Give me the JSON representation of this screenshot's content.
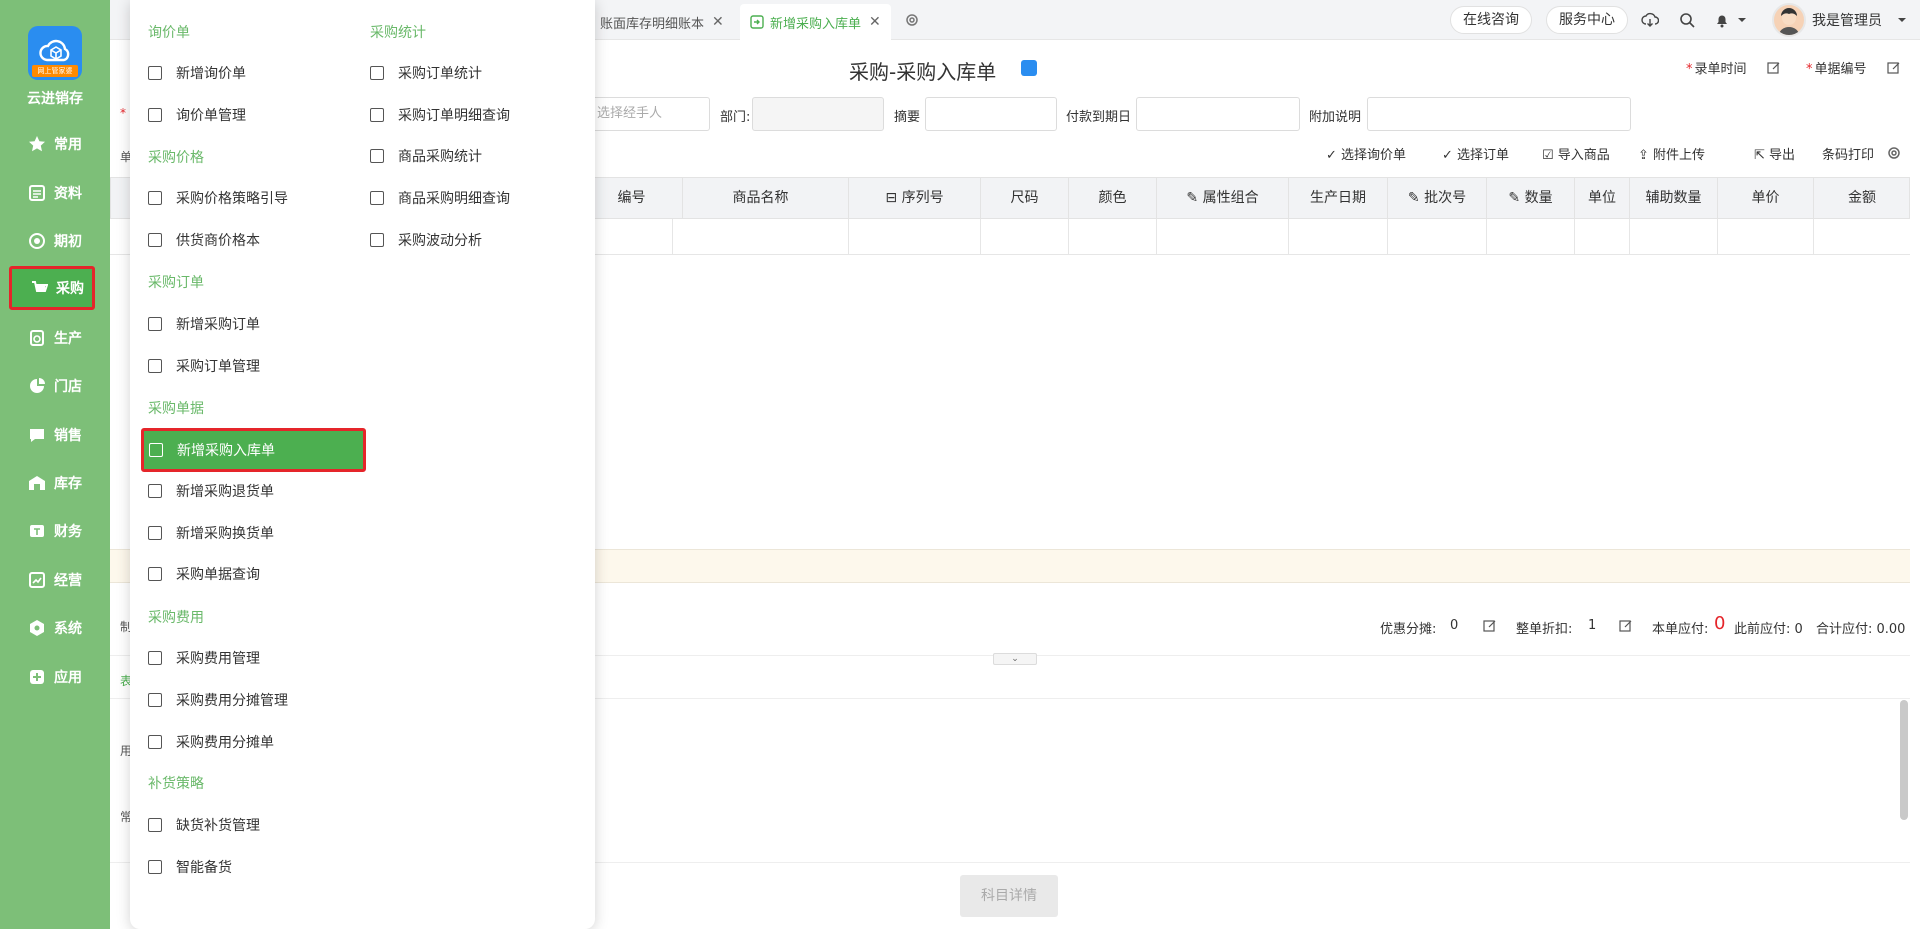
{
  "sidebar": {
    "brand": "云进销存",
    "logo_badge": "网上管家婆",
    "items": [
      {
        "label": "常用",
        "icon": "star-icon"
      },
      {
        "label": "资料",
        "icon": "document-icon"
      },
      {
        "label": "期初",
        "icon": "target-icon"
      },
      {
        "label": "采购",
        "icon": "cart-icon",
        "active": true
      },
      {
        "label": "生产",
        "icon": "gear-doc-icon"
      },
      {
        "label": "门店",
        "icon": "pie-icon"
      },
      {
        "label": "销售",
        "icon": "chat-icon"
      },
      {
        "label": "库存",
        "icon": "warehouse-icon"
      },
      {
        "label": "财务",
        "icon": "finance-icon"
      },
      {
        "label": "经营",
        "icon": "trend-icon"
      },
      {
        "label": "系统",
        "icon": "hexagon-icon"
      },
      {
        "label": "应用",
        "icon": "plus-square-icon"
      }
    ]
  },
  "tabs": [
    {
      "label": "账面库存明细账本",
      "active": false
    },
    {
      "label": "新增采购入库单",
      "active": true
    }
  ],
  "topbar": {
    "online_consult": "在线咨询",
    "service_center": "服务中心",
    "username": "我是管理员"
  },
  "form": {
    "title": "采购-采购入库单",
    "record_time_label": "录单时间",
    "doc_number_label": "单据编号",
    "handler_placeholder": "选择经手人",
    "dept_label": "部门:",
    "summary_label": "摘要",
    "due_date_label": "付款到期日",
    "extra_label": "附加说明",
    "leading_req": "*",
    "leading_frag": "单"
  },
  "toolbar": {
    "select_inquiry": "选择询价单",
    "select_order": "选择订单",
    "import_goods": "导入商品",
    "upload_attachment": "附件上传",
    "export": "导出",
    "barcode_print": "条码打印"
  },
  "table": {
    "columns": [
      "编号",
      "商品名称",
      "序列号",
      "尺码",
      "颜色",
      "属性组合",
      "生产日期",
      "批次号",
      "数量",
      "单位",
      "辅助数量",
      "单价",
      "金额"
    ]
  },
  "footer": {
    "discount_share_label": "优惠分摊:",
    "discount_share_value": "0",
    "whole_discount_label": "整单折扣:",
    "whole_discount_value": "1",
    "current_payable_label": "本单应付:",
    "current_payable_value": "0",
    "previous_payable_label": "此前应付: 0",
    "total_payable_label": "合计应付: 0.00",
    "subject_detail_button": "科目详情",
    "left_frags": [
      "制",
      "表",
      "用",
      "常"
    ]
  },
  "menu": {
    "groups": [
      {
        "title": "询价单",
        "items": [
          "新增询价单",
          "询价单管理"
        ]
      },
      {
        "title": "采购价格",
        "items": [
          "采购价格策略引导",
          "供货商价格本"
        ]
      },
      {
        "title": "采购订单",
        "items": [
          "新增采购订单",
          "采购订单管理"
        ]
      },
      {
        "title": "采购单据",
        "items": [
          "新增采购入库单",
          "新增采购退货单",
          "新增采购换货单",
          "采购单据查询"
        ]
      },
      {
        "title": "采购费用",
        "items": [
          "采购费用管理",
          "采购费用分摊管理",
          "采购费用分摊单"
        ]
      },
      {
        "title": "补货策略",
        "items": [
          "缺货补货管理",
          "智能备货"
        ]
      },
      {
        "title": "采购统计",
        "items": [
          "采购订单统计",
          "采购订单明细查询",
          "商品采购统计",
          "商品采购明细查询",
          "采购波动分析"
        ]
      }
    ],
    "active_item": "新增采购入库单"
  },
  "colors": {
    "sidebar_bg": "#7dbf78",
    "accent_green": "#4caf50",
    "highlight_red": "#e5252a",
    "brand_blue": "#2a8df0"
  }
}
